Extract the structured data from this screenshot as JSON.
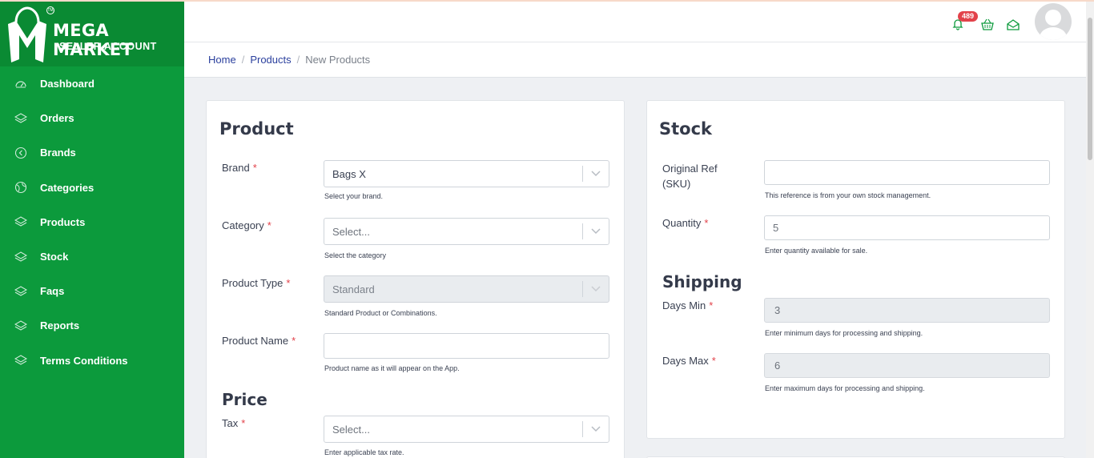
{
  "brand": {
    "title": "MEGA MARKET",
    "subtitle": "SELLER ACCOUNT",
    "tm": "TM"
  },
  "sidebar": {
    "items": [
      {
        "label": "Dashboard",
        "icon": "dashboard-gauge-icon"
      },
      {
        "label": "Orders",
        "icon": "layers-icon"
      },
      {
        "label": "Brands",
        "icon": "circle-chevron-left-icon"
      },
      {
        "label": "Categories",
        "icon": "globe-icon"
      },
      {
        "label": "Products",
        "icon": "layers-icon"
      },
      {
        "label": "Stock",
        "icon": "layers-icon"
      },
      {
        "label": "Faqs",
        "icon": "layers-icon"
      },
      {
        "label": "Reports",
        "icon": "layers-icon"
      },
      {
        "label": "Terms Conditions",
        "icon": "layers-icon"
      }
    ]
  },
  "header": {
    "notification_count": "489",
    "icons": [
      "bell-icon",
      "basket-icon",
      "envelope-icon",
      "user-avatar"
    ]
  },
  "breadcrumb": {
    "home": "Home",
    "products": "Products",
    "current": "New Products",
    "separator": "/"
  },
  "product_card": {
    "title": "Product",
    "brand": {
      "label": "Brand",
      "value": "Bags X",
      "help": "Select your brand."
    },
    "category": {
      "label": "Category",
      "placeholder": "Select...",
      "help": "Select the category"
    },
    "product_type": {
      "label": "Product Type",
      "value": "Standard",
      "help": "Standard Product or Combinations."
    },
    "product_name": {
      "label": "Product Name",
      "value": "",
      "help": "Product name as it will appear on the App."
    },
    "price_title": "Price",
    "tax": {
      "label": "Tax",
      "placeholder": "Select...",
      "help": "Enter applicable tax rate."
    },
    "required_mark": "*"
  },
  "stock_card": {
    "title": "Stock",
    "original_ref": {
      "label": "Original Ref (SKU)",
      "value": "",
      "help": "This reference is from your own stock management."
    },
    "quantity": {
      "label": "Quantity",
      "value": "5",
      "help": "Enter quantity available for sale."
    },
    "shipping_title": "Shipping",
    "days_min": {
      "label": "Days Min",
      "value": "3",
      "help": "Enter minimum days for processing and shipping."
    },
    "days_max": {
      "label": "Days Max",
      "value": "6",
      "help": "Enter maximum days for processing and shipping."
    },
    "required_mark": "*"
  },
  "colors": {
    "sidebar": "#0c9a3c",
    "logo_bg": "#0a8a33",
    "link": "#2a3f9d",
    "required": "#e2424a",
    "badge": "#e2424a"
  }
}
